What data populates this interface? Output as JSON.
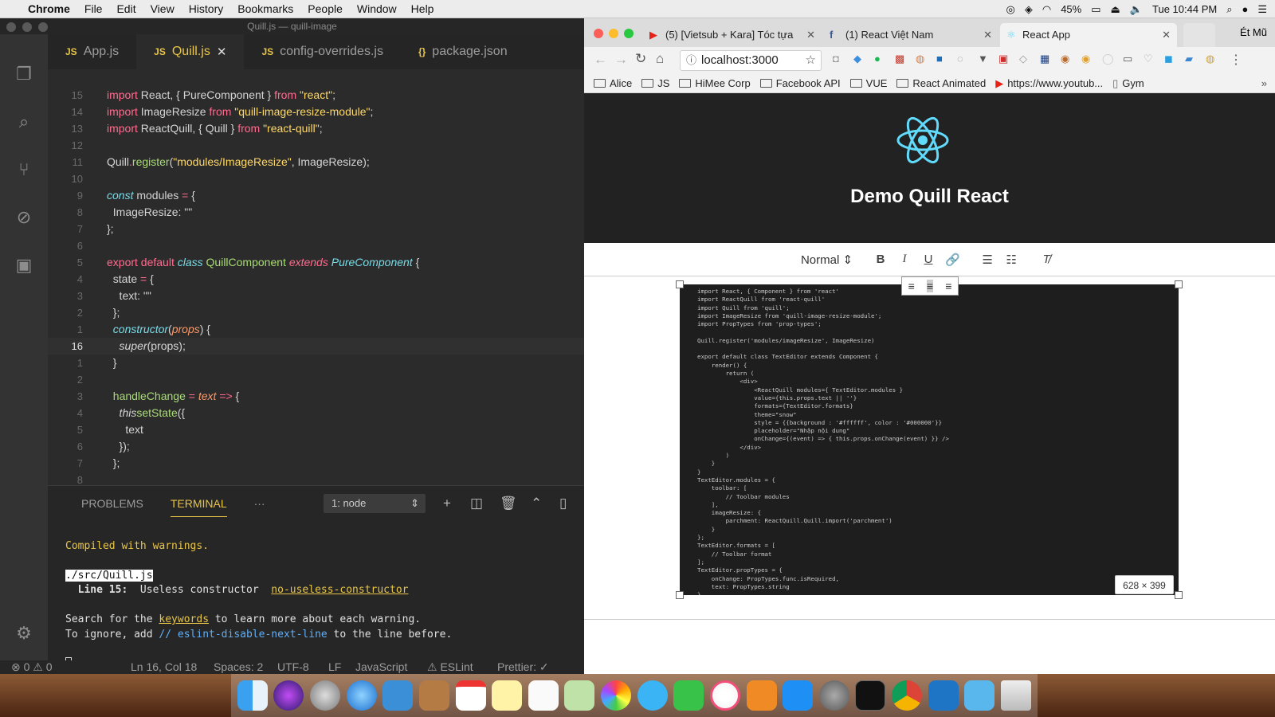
{
  "menubar": {
    "app": "Chrome",
    "items": [
      "File",
      "Edit",
      "View",
      "History",
      "Bookmarks",
      "People",
      "Window",
      "Help"
    ],
    "battery": "45%",
    "clock": "Tue 10:44 PM"
  },
  "vscode": {
    "window_title": "Quill.js — quill-image",
    "tabs": [
      {
        "icon": "JS",
        "label": "App.js"
      },
      {
        "icon": "JS",
        "label": "Quill.js",
        "close": "✕"
      },
      {
        "icon": "JS",
        "label": "config-overrides.js"
      },
      {
        "icon": "{}",
        "label": "package.json"
      }
    ],
    "line_numbers": [
      "15",
      "14",
      "13",
      "12",
      "11",
      "10",
      "9",
      "8",
      "7",
      "6",
      "5",
      "4",
      "3",
      "2",
      "1",
      "16",
      "1",
      "2",
      "3",
      "4",
      "5",
      "6",
      "7",
      "8"
    ],
    "code": {
      "l0_a": "import",
      "l0_b": " React, { PureComponent } ",
      "l0_c": "from",
      "l0_d": "\"react\"",
      "l0_e": ";",
      "l1_a": "import",
      "l1_b": " ImageResize ",
      "l1_c": "from",
      "l1_d": "\"quill-image-resize-module\"",
      "l1_e": ";",
      "l2_a": "import",
      "l2_b": " ReactQuill, { Quill } ",
      "l2_c": "from",
      "l2_d": "\"react-quill\"",
      "l2_e": ";",
      "l4_a": "Quill",
      "l4_b": ".",
      "l4_c": "register",
      "l4_d": "(",
      "l4_e": "\"modules/ImageResize\"",
      "l4_f": ", ImageResize);",
      "l6_a": "const",
      "l6_b": " modules ",
      "l6_c": "=",
      "l6_d": " {",
      "l7_a": "  ImageResize",
      ": ": ": \"\"",
      "l8": "};",
      "l10_a": "export default ",
      "l10_b": "class ",
      "l10_c": "QuillComponent ",
      "l10_d": "extends ",
      "l10_e": "PureComponent",
      " ": " {",
      "l11_a": "  state ",
      "l11_b": "=",
      "l11_c": " {",
      "l12_a": "    text",
      "l13": "  };",
      "l14_a": "  constructor",
      "l14_b": "(",
      "l14_c": "props",
      "l14_d": ") {",
      "l15_a": "    super",
      "l15_b": "(props);",
      "l16": "  }",
      "l18_a": "  handleChange ",
      "l18_b": "= ",
      "l18_c": "text ",
      "l18_d": "=>",
      "l19_a": "    this",
      ".": ".",
      "l19_c": "setState",
      "l19_d": "({",
      "l20": "      text",
      "l21": "    });",
      "l22": "  };"
    },
    "panel": {
      "tabs": [
        "PROBLEMS",
        "TERMINAL",
        "···"
      ],
      "terminal_select": "1: node",
      "terminal": {
        "compiled": "Compiled with warnings.",
        "file": "./src/Quill.js",
        "line_label": "Line 15:",
        "warning": "  Useless constructor  ",
        "rule": "no-useless-constructor",
        "search_a": "Search for the ",
        "keywords": "keywords",
        "search_b": " to learn more about each warning.",
        "ignore_a": "To ignore, add ",
        "ignore_comment": "// eslint-disable-next-line",
        "ignore_b": " to the line before."
      }
    },
    "status": {
      "errors": "⊗ 0 ⚠ 0",
      "position": "Ln 16, Col 18",
      "spaces": "Spaces: 2",
      "encoding": "UTF-8",
      "eol": "LF",
      "language": "JavaScript",
      "eslint": "⚠ ESLint",
      "prettier": "Prettier: ✓"
    }
  },
  "chrome": {
    "tabs": [
      {
        "label": "(5) [Vietsub + Kara] Tóc tựa"
      },
      {
        "label": "(1) React Việt Nam"
      },
      {
        "label": "React App"
      }
    ],
    "profile": "Ét Mũ",
    "url": "localhost:3000",
    "bookmarks": [
      "Alice",
      "JS",
      "HiMee Corp",
      "Facebook API",
      "VUE",
      "React Animated",
      "https://www.youtub...",
      "Gym"
    ],
    "page": {
      "title": "Demo Quill React",
      "format_select": "Normal",
      "image_size": "628 × 399",
      "snippet": [
        "import React, { Component } from 'react'",
        "import ReactQuill from 'react-quill'",
        "import Quill from 'quill';",
        "import ImageResize from 'quill-image-resize-module';",
        "import PropTypes from 'prop-types';",
        "",
        "Quill.register('modules/imageResize', ImageResize)",
        "",
        "export default class TextEditor extends Component {",
        "    render() {",
        "        return (",
        "            <div>",
        "                <ReactQuill modules={ TextEditor.modules }",
        "                value={this.props.text || ''}",
        "                formats={TextEditor.formats}",
        "                theme=\"snow\"",
        "                style = {{background : '#ffffff', color : '#000000'}}",
        "                placeholder=\"Nhập nội dung\"",
        "                onChange={(event) => { this.props.onChange(event) }} />",
        "            </div>",
        "        )",
        "    }",
        "}",
        "TextEditor.modules = {",
        "    toolbar: [",
        "        // Toolbar modules",
        "    ],",
        "    imageResize: {",
        "        parchment: ReactQuill.Quill.import('parchment')",
        "    }",
        "};",
        "TextEditor.formats = [",
        "    // Toolbar format",
        "];",
        "TextEditor.propTypes = {",
        "    onChange: PropTypes.func.isRequired,",
        "    text: PropTypes.string",
        "}"
      ]
    }
  }
}
